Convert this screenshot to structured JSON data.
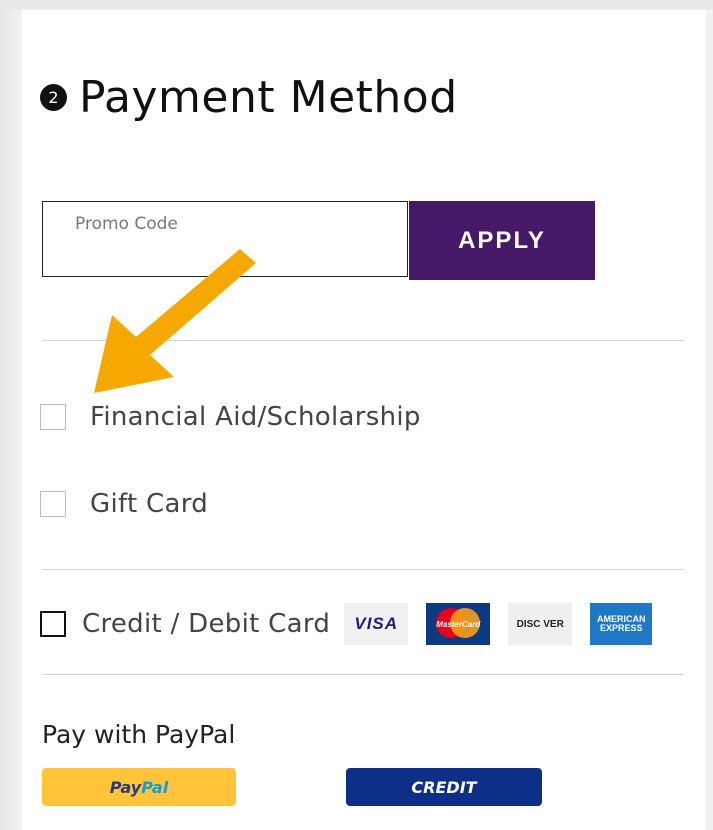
{
  "section": {
    "step_number": "2",
    "title": "Payment Method"
  },
  "promo": {
    "placeholder": "Promo Code",
    "apply_label": "APPLY"
  },
  "options": {
    "financial_aid": "Financial Aid/Scholarship",
    "gift_card": "Gift Card",
    "credit_card": "Credit / Debit Card"
  },
  "card_logos": {
    "visa": "VISA",
    "mastercard": "MasterCard",
    "discover": "DISC VER",
    "amex": "AMERICAN EXPRESS"
  },
  "paypal": {
    "title": "Pay with PayPal",
    "paypal_button_a": "Pay",
    "paypal_button_b": "Pal",
    "credit_button": "CREDIT"
  },
  "colors": {
    "apply_bg": "#451967",
    "arrow": "#f5a800",
    "paypal_yellow": "#ffc439",
    "paypal_blue": "#0d2f88"
  }
}
